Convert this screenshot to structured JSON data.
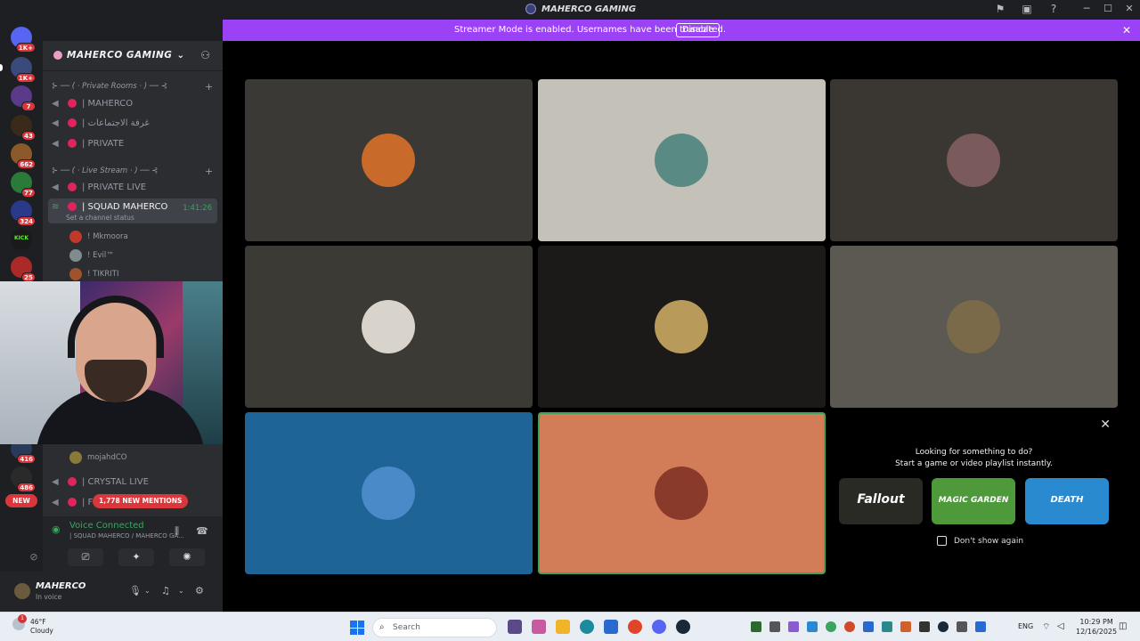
{
  "window": {
    "title": "MAHERCO GAMING",
    "title_icon": "discord-server-icon"
  },
  "banner": {
    "message": "Streamer Mode is enabled. Usernames have been truncated.",
    "button": "Disable",
    "color": "#9b41f6"
  },
  "servers": [
    {
      "badge": "1K+",
      "color": "#5865f2",
      "icon": "discord-home-icon"
    },
    {
      "badge": "1K+",
      "color": "#3a4a7a"
    },
    {
      "badge": "7",
      "color": "#5b3a8a"
    },
    {
      "badge": "43",
      "color": "#3a2a1a"
    },
    {
      "badge": "662",
      "color": "#8a5a2a"
    },
    {
      "badge": "77",
      "color": "#2a7a3a"
    },
    {
      "badge": "324",
      "color": "#2a3a8a"
    },
    {
      "badge": "",
      "color": "#1a1a1a",
      "label": "KICK"
    },
    {
      "badge": "25",
      "color": "#aa2a2a"
    }
  ],
  "servers_lower": [
    {
      "badge": "416",
      "color": "#2a3a5a"
    },
    {
      "badge": "486",
      "color": "#2a2a2a"
    }
  ],
  "new_pill": "NEW",
  "guild": {
    "name": "MAHERCO GAMING"
  },
  "categories": {
    "private_rooms": "⊱ ── ( · Private Rooms · ) ── ⊰",
    "live_stream": "⊱ ── ( · Live Stream · ) ── ⊰"
  },
  "channels": {
    "maherco": "| MAHERCO",
    "meetings": "| غرفة الاجتماعات",
    "private": "| PRIVATE",
    "private_live": "| PRIVATE LIVE",
    "squad": "| SQUAD MAHERCO",
    "squad_time": "1:41:26",
    "squad_status": "Set a channel status",
    "crystal": "| CRYSTAL LIVE",
    "partial": "| F"
  },
  "members": {
    "m1": "! Mkmoora",
    "m2": "! Evil™",
    "m3": "! TIKRITI",
    "m4": "mojahdCO"
  },
  "mentions": "1,778 NEW MENTIONS",
  "voice": {
    "title": "Voice Connected",
    "sub": "| SQUAD MAHERCO / MAHERCO GA..."
  },
  "user": {
    "name": "MAHERCO",
    "status": "In voice"
  },
  "activity": {
    "line1": "Looking for something to do?",
    "line2": "Start a game or video playlist instantly.",
    "games": [
      {
        "name": "Fallout",
        "color": "#2a2a24"
      },
      {
        "name": "MAGIC GARDEN",
        "color": "#4e9a3a"
      },
      {
        "name": "DEATH",
        "color": "#2a8ad0"
      }
    ],
    "checkbox": "Don't show again"
  },
  "tiles": [
    {
      "bg": "#3a3936",
      "avatar": "#c86a2a"
    },
    {
      "bg": "#c3c1b8",
      "avatar": "#5a8a84"
    },
    {
      "bg": "#3a3733",
      "avatar": "#7a5a5a"
    },
    {
      "bg": "#3c3a35",
      "avatar": "#d8d4cc"
    },
    {
      "bg": "#1c1a18",
      "avatar": "#b89a5a"
    },
    {
      "bg": "#5b5952",
      "avatar": "#7a6a4a"
    },
    {
      "bg": "#1f6497",
      "avatar": "#4a8ac8"
    },
    {
      "bg": "#d27d58",
      "avatar": "#8a3a2a"
    }
  ],
  "taskbar": {
    "temp": "46°F",
    "cond": "Cloudy",
    "weather_badge": "1",
    "search": "Search",
    "lang": "ENG",
    "time": "10:29 PM",
    "date": "12/16/2025"
  }
}
